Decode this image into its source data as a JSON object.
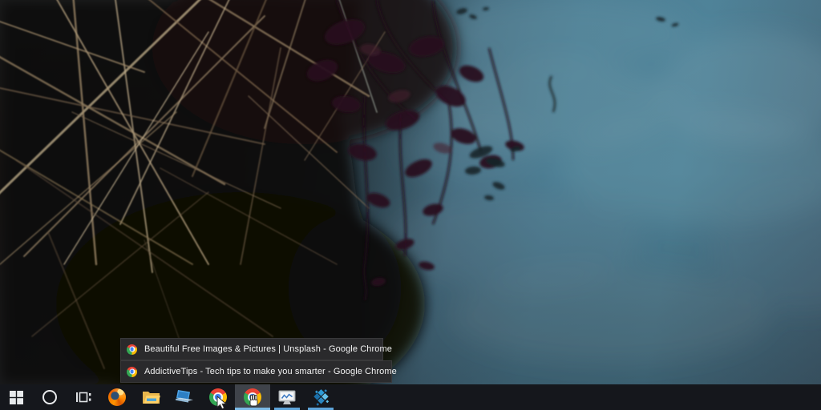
{
  "wallpaper": {
    "description": "dark pond water photo: dry tan grass and maroon leafy branches on the left reflected over teal-blue water",
    "water_color": "#4c7e94",
    "shadow_color": "#120d0b"
  },
  "flyout": {
    "background": "#2b2b2d",
    "text_color": "#f2f2f2",
    "items": [
      {
        "icon": "chrome-icon",
        "title": "Beautiful Free Images & Pictures | Unsplash - Google Chrome"
      },
      {
        "icon": "chrome-icon",
        "title": "AddictiveTips - Tech tips to make you smarter - Google Chrome"
      }
    ]
  },
  "taskbar": {
    "background": "#15171c",
    "active_button_background": "#3f434a",
    "running_indicator_color": "#5ea4d9",
    "hovered_indicator_color": "#7cbbe8",
    "buttons": [
      {
        "name": "start",
        "icon": "windows-start-icon",
        "running": false,
        "highlighted": false
      },
      {
        "name": "cortana",
        "icon": "cortana-circle-icon",
        "running": false,
        "highlighted": false
      },
      {
        "name": "task-view",
        "icon": "task-view-icon",
        "running": false,
        "highlighted": false
      },
      {
        "name": "firefox",
        "icon": "firefox-icon",
        "running": false,
        "highlighted": false
      },
      {
        "name": "file-explorer",
        "icon": "file-explorer-icon",
        "running": false,
        "highlighted": false
      },
      {
        "name": "laptop-app",
        "icon": "laptop-icon",
        "running": false,
        "highlighted": false
      },
      {
        "name": "chrome",
        "icon": "chrome-icon",
        "running": false,
        "highlighted": false
      },
      {
        "name": "chrome-active",
        "icon": "chrome-icon",
        "running": true,
        "highlighted": true
      },
      {
        "name": "performance-monitor-app",
        "icon": "monitor-chart-icon",
        "running": true,
        "highlighted": false
      },
      {
        "name": "cube-app",
        "icon": "blue-cube-icon",
        "running": true,
        "highlighted": false
      }
    ]
  },
  "cursors": [
    {
      "icon": "mouse-arrow-cursor-icon",
      "over": "chrome"
    },
    {
      "icon": "mouse-hand-cursor-icon",
      "over": "chrome-active"
    }
  ]
}
